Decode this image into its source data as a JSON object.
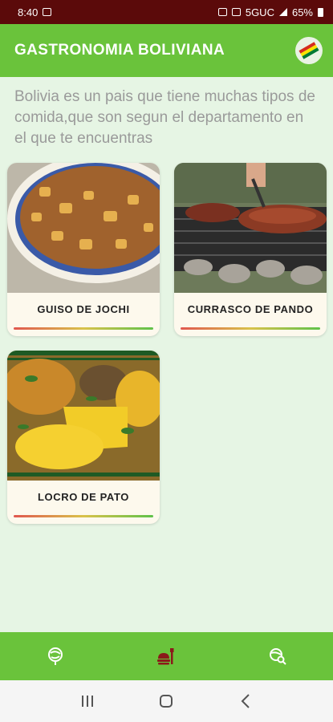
{
  "status_bar": {
    "time": "8:40",
    "network": "5GUC",
    "battery": "65%"
  },
  "app_bar": {
    "title": "GASTRONOMIA BOLIVIANA"
  },
  "intro_text": "Bolivia es un pais que tiene muchas tipos de comida,que son segun el departamento en el que te encuentras",
  "dishes": [
    {
      "name": "GUISO DE JOCHI"
    },
    {
      "name": "CURRASCO DE PANDO"
    },
    {
      "name": "LOCRO DE PATO"
    }
  ],
  "icons": {
    "language_flag": "bolivia-flag-icon",
    "nav_home": "globe-leaf-icon",
    "nav_food": "food-icon",
    "nav_search": "search-map-icon"
  },
  "colors": {
    "primary_green": "#6ac33b",
    "status_bar": "#5b0a0a",
    "background": "#e6f5e4",
    "card": "#fdf9ed",
    "food_icon": "#8b1a1a"
  }
}
